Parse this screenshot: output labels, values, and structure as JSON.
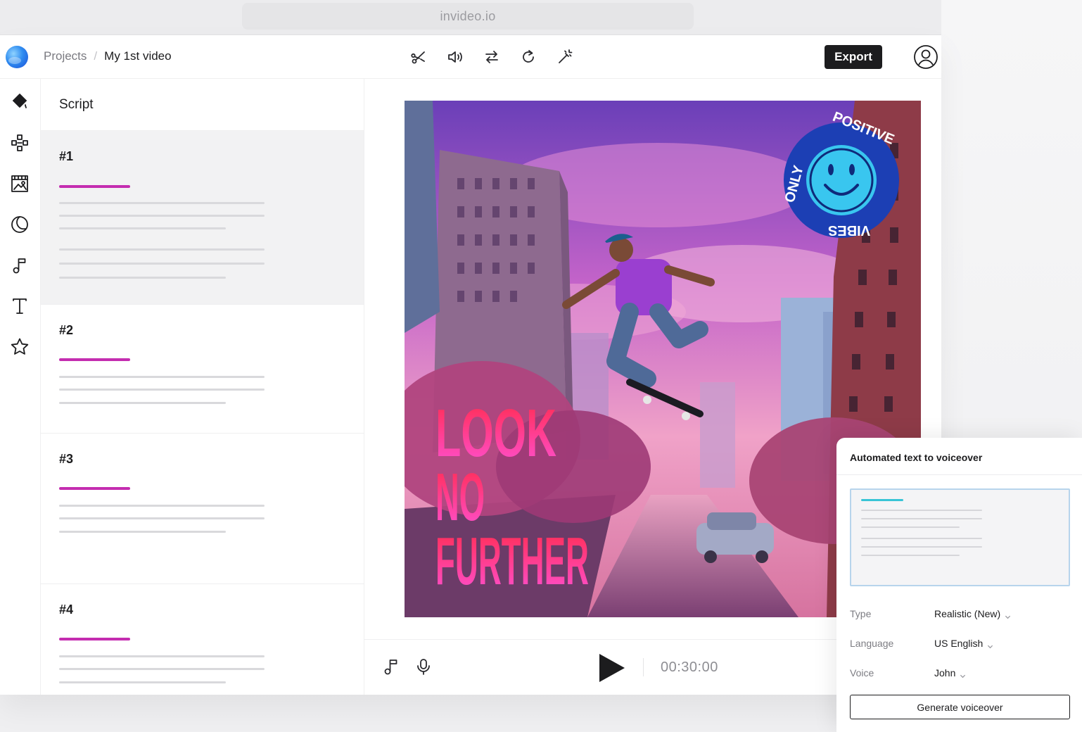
{
  "browser": {
    "url": "invideo.io"
  },
  "header": {
    "breadcrumb_root": "Projects",
    "breadcrumb_sep": "/",
    "project_name": "My 1st video",
    "export_label": "Export",
    "tools": [
      "scissors-icon",
      "volume-icon",
      "swap-icon",
      "redo-icon",
      "magic-wand-icon"
    ]
  },
  "rail": {
    "icons": [
      "paint-bucket-icon",
      "elements-icon",
      "media-icon",
      "sticker-icon",
      "music-icon",
      "text-icon",
      "star-icon"
    ]
  },
  "script": {
    "title": "Script",
    "scenes": [
      {
        "label": "#1"
      },
      {
        "label": "#2"
      },
      {
        "label": "#3"
      },
      {
        "label": "#4"
      }
    ]
  },
  "preview": {
    "headline": [
      "LOOK",
      "NO",
      "FURTHER"
    ],
    "badge_top": "POSITIVE",
    "badge_left": "ONLY",
    "badge_bottom": "VIBES"
  },
  "player": {
    "timecode": "00:30:00"
  },
  "voiceover": {
    "title": "Automated text to voiceover",
    "type_label": "Type",
    "type_value": "Realistic (New)",
    "language_label": "Language",
    "language_value": "US English",
    "voice_label": "Voice",
    "voice_value": "John",
    "generate_label": "Generate voiceover"
  },
  "colors": {
    "accent_magenta": "#c42db0",
    "accent_cyan": "#38c4d6",
    "dark": "#1c1c1e"
  }
}
